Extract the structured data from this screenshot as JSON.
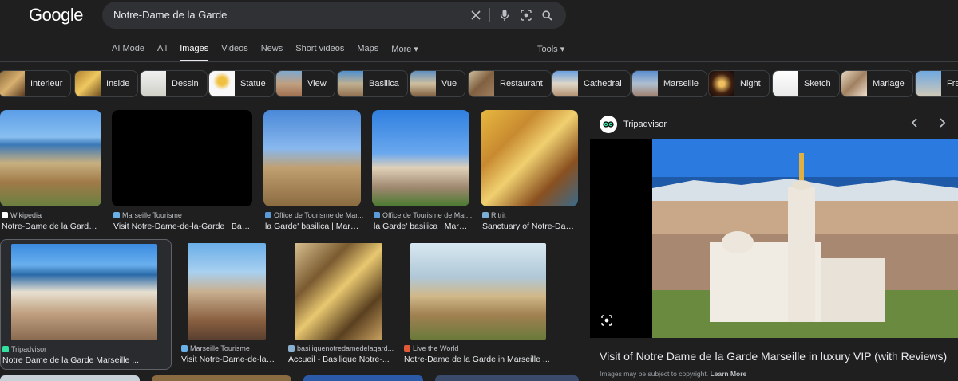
{
  "header": {
    "logo": "Google",
    "query": "Notre-Dame de la Garde",
    "icons": [
      "clear-icon",
      "microphone-icon",
      "lens-icon",
      "search-icon"
    ]
  },
  "tabs": [
    "AI Mode",
    "All",
    "Images",
    "Videos",
    "News",
    "Short videos",
    "Maps",
    "More ▾"
  ],
  "active_tab": "Images",
  "tools_label": "Tools ▾",
  "chips": [
    "Interieur",
    "Inside",
    "Dessin",
    "Statue",
    "View",
    "Basilica",
    "Vue",
    "Restaurant",
    "Cathedral",
    "Marseille",
    "Night",
    "Sketch",
    "Mariage",
    "Fra"
  ],
  "results": [
    {
      "source": "Wikipedia",
      "title": "Notre-Dame de la Garde ..."
    },
    {
      "source": "Marseille Tourisme",
      "title": "Visit Notre-Dame-de-la-Garde | Basili..."
    },
    {
      "source": "Office de Tourisme de Mar...",
      "title": "la Garde' basilica | Mars..."
    },
    {
      "source": "Office de Tourisme de Mar...",
      "title": "la Garde' basilica | Mars..."
    },
    {
      "source": "Ritrit",
      "title": "Sanctuary of Notre-Dam..."
    },
    {
      "source": "Tripadvisor",
      "title": "Notre Dame de la Garde Marseille ..."
    },
    {
      "source": "Marseille Tourisme",
      "title": "Visit Notre-Dame-de-la-..."
    },
    {
      "source": "basiliquenotredamedelagard...",
      "title": "Accueil - Basilique Notre-..."
    },
    {
      "source": "Live the World",
      "title": "Notre-Dame de la Garde in Marseille ..."
    }
  ],
  "preview": {
    "source": "Tripadvisor",
    "title": "Visit of Notre Dame de la Garde Marseille in luxury VIP (with Reviews)",
    "copyright": "Images may be subject to copyright.",
    "learn_more": "Learn More",
    "prev_icon": "chevron-left-icon",
    "next_icon": "chevron-right-icon"
  },
  "colors": {
    "background": "#1f1f1f",
    "search_bg": "#303134",
    "text": "#e8eaed",
    "muted": "#bdc1c6",
    "tripadvisor": "#34e0a1"
  }
}
